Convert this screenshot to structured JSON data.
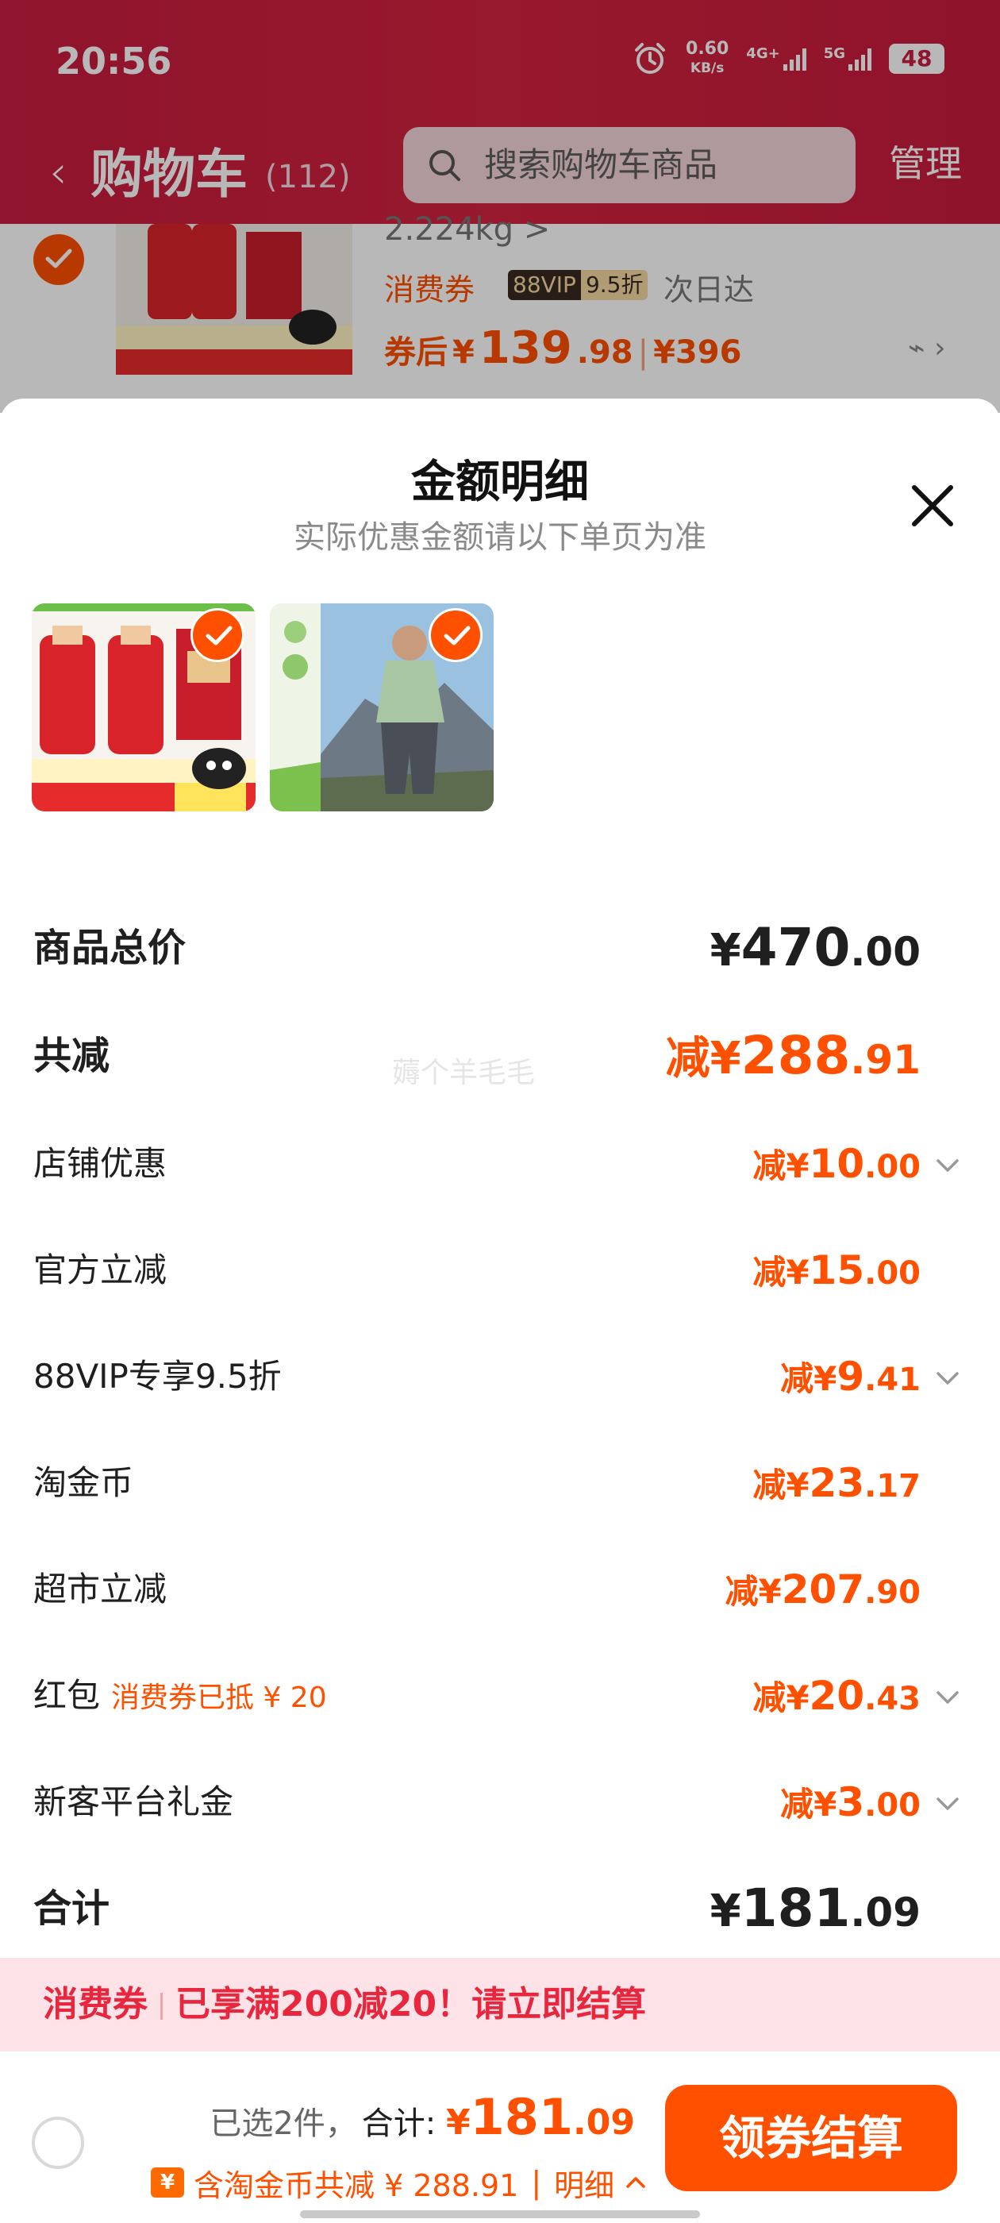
{
  "status_bar": {
    "time": "20:56",
    "speed_value": "0.60",
    "speed_unit": "KB/s",
    "net1": "4G+",
    "net2": "5G",
    "battery": "48",
    "alarm_icon": "alarm-clock-icon"
  },
  "cart_header": {
    "back_icon": "chevron-left-icon",
    "title": "购物车",
    "count": "(112)",
    "search_placeholder": "搜索购物车商品",
    "manage_label": "管理",
    "bg_color": "#c81c3f"
  },
  "background_item": {
    "weight": "2.224kg >",
    "coupon_label": "消费券",
    "vip_badge": "88VIP",
    "vip_discount": "9.5折",
    "delivery": "次日达",
    "price_prefix": "券后",
    "price_currency": "¥",
    "price_int": "139",
    "price_dec": ".98",
    "price_sep": "|",
    "original_price": "¥396"
  },
  "sheet": {
    "title": "金额明细",
    "subtitle": "实际优惠金额请以下单页为准",
    "close_icon": "close-icon",
    "watermark": "薅个羊毛毛"
  },
  "thumbnails": [
    {
      "name": "liquor-product-image",
      "checked": true
    },
    {
      "name": "tshirt-product-image",
      "checked": true
    }
  ],
  "rows": [
    {
      "label": "商品总价",
      "prefix": "¥",
      "int": "470",
      "dec": ".00",
      "style": "total"
    },
    {
      "label": "共减",
      "prefix": "减¥",
      "int": "288",
      "dec": ".91",
      "style": "reduce-total"
    },
    {
      "label": "店铺优惠",
      "prefix": "减¥",
      "int": "10",
      "dec": ".00",
      "chevron": true
    },
    {
      "label": "官方立减",
      "prefix": "减¥",
      "int": "15",
      "dec": ".00",
      "chevron": false
    },
    {
      "label": "88VIP专享9.5折",
      "prefix": "减¥",
      "int": "9",
      "dec": ".41",
      "chevron": true
    },
    {
      "label": "淘金币",
      "prefix": "减¥",
      "int": "23",
      "dec": ".17",
      "chevron": false
    },
    {
      "label": "超市立减",
      "prefix": "减¥",
      "int": "207",
      "dec": ".90",
      "chevron": false
    },
    {
      "label": "红包",
      "note": "消费券已抵 ¥ 20",
      "prefix": "减¥",
      "int": "20",
      "dec": ".43",
      "chevron": true
    },
    {
      "label": "新客平台礼金",
      "prefix": "减¥",
      "int": "3",
      "dec": ".00",
      "chevron": true
    },
    {
      "label": "合计",
      "prefix": "¥",
      "int": "181",
      "dec": ".09",
      "style": "total"
    }
  ],
  "promo": {
    "label": "消费券",
    "text": "已享满200减20！请立即结算"
  },
  "bottom_bar": {
    "selected_text": "已选2件，",
    "total_label": "合计:",
    "currency": "¥",
    "total_int": "181",
    "total_dec": ".09",
    "coin_icon_text": "¥",
    "coin_text": "含淘金币共减 ¥ 288.91",
    "coin_sep": "|",
    "detail_label": "明细",
    "checkout_label": "领券结算"
  },
  "colors": {
    "accent": "#ff5000",
    "header": "#c81c3f",
    "promo_bg": "#fde3e7",
    "promo_text": "#e8273f"
  }
}
